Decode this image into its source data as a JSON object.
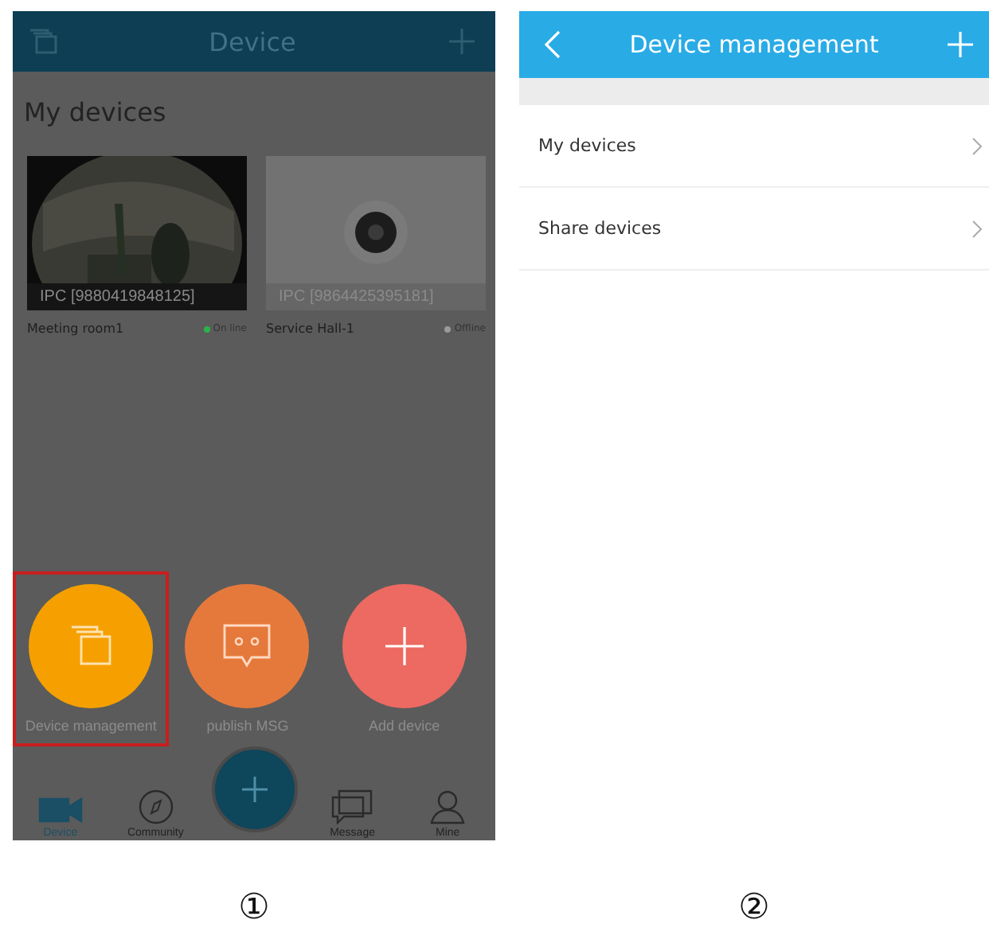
{
  "screen_1": {
    "header": {
      "title": "Device"
    },
    "section_title": "My devices",
    "devices": [
      {
        "id_label": "IPC [9880419848125]",
        "name": "Meeting room1",
        "status": "On line",
        "color": "#2bb34a"
      },
      {
        "id_label": "IPC [9864425395181]",
        "name": "Service Hall-1",
        "status": "Offline",
        "color": "#9a9a9a"
      }
    ],
    "actions": [
      {
        "label": "Device management",
        "kind": "manage",
        "selected": true
      },
      {
        "label": "publish MSG",
        "kind": "message",
        "selected": false
      },
      {
        "label": "Add device",
        "kind": "add",
        "selected": false
      }
    ],
    "tabs": [
      {
        "label": "Device",
        "kind": "camera",
        "selected": true
      },
      {
        "label": "Community",
        "kind": "compass",
        "selected": false
      },
      {
        "label": "Message",
        "kind": "chat",
        "selected": false
      },
      {
        "label": "Mine",
        "kind": "person",
        "selected": false
      }
    ],
    "caption": "①"
  },
  "screen_2": {
    "header": {
      "title": "Device management"
    },
    "items": [
      "My devices",
      "Share devices"
    ],
    "caption": "②"
  }
}
